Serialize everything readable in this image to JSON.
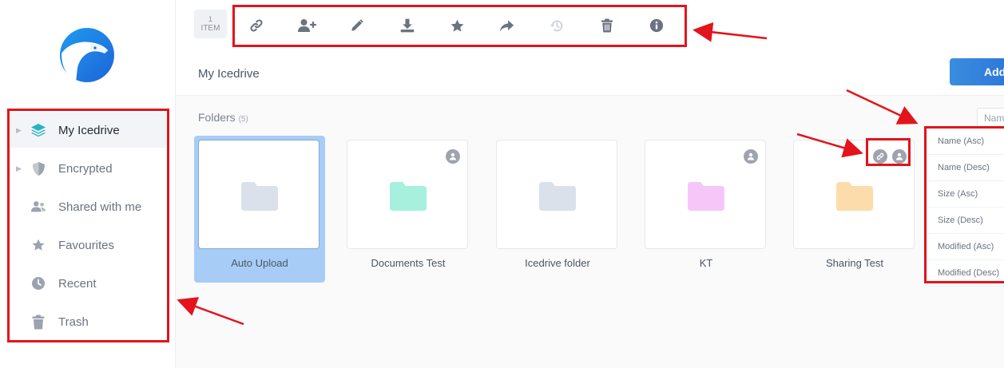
{
  "sidebar": {
    "items": [
      {
        "label": "My Icedrive",
        "icon": "layers-icon"
      },
      {
        "label": "Encrypted",
        "icon": "shield-icon"
      },
      {
        "label": "Shared with me",
        "icon": "users-icon"
      },
      {
        "label": "Favourites",
        "icon": "star-icon"
      },
      {
        "label": "Recent",
        "icon": "clock-icon"
      },
      {
        "label": "Trash",
        "icon": "trash-icon"
      }
    ]
  },
  "toolbar": {
    "count_number": "1",
    "count_label": "ITEM",
    "tools": [
      "link-icon",
      "add-user-icon",
      "pencil-icon",
      "download-icon",
      "star-icon",
      "share-icon",
      "restore-icon",
      "trash-icon",
      "info-icon"
    ]
  },
  "header": {
    "breadcrumb": "My Icedrive",
    "add_label": "Add"
  },
  "folders_section": {
    "title": "Folders",
    "count": "(5)"
  },
  "folders": [
    {
      "name": "Auto Upload",
      "color": "#dbe1ea",
      "selected": true
    },
    {
      "name": "Documents Test",
      "color": "#a6f0dd",
      "shared": true
    },
    {
      "name": "Icedrive folder",
      "color": "#dbe1ea"
    },
    {
      "name": "KT",
      "color": "#f7c6f8",
      "shared": true
    },
    {
      "name": "Sharing Test",
      "color": "#fcdcaa",
      "shared": true,
      "linked": true
    }
  ],
  "sort": {
    "input_text": "Nam",
    "options": [
      "Name (Asc)",
      "Name (Desc)",
      "Size (Asc)",
      "Size (Desc)",
      "Modified (Asc)",
      "Modified (Desc)"
    ]
  },
  "colors": {
    "accent": "#2b72d9",
    "annotation_red": "#e3141b",
    "selected_bg": "#a7cdf6",
    "icon_gray": "#6b7280"
  }
}
